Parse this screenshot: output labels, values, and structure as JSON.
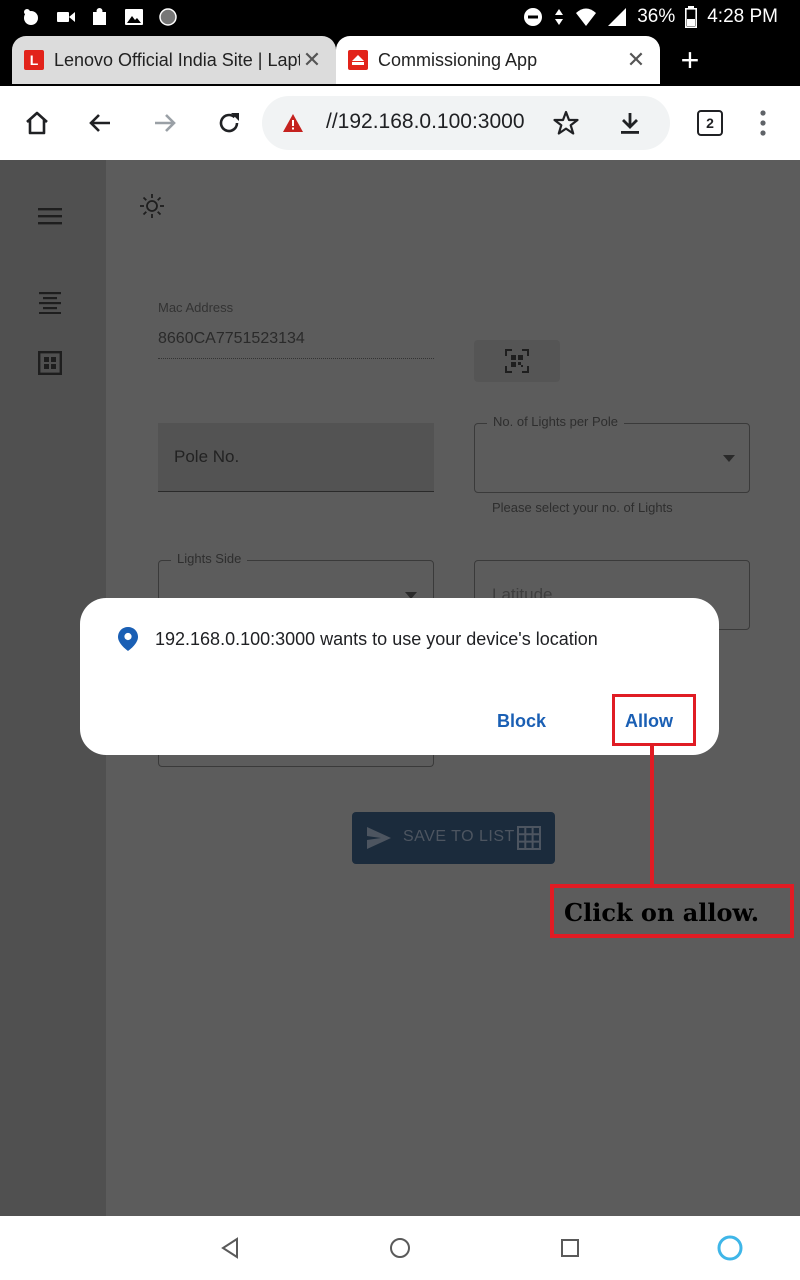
{
  "status_bar": {
    "battery": "36%",
    "time": "4:28 PM"
  },
  "tabs": [
    {
      "title": "Lenovo Official India Site | Laptops",
      "favicon_letter": "L",
      "favicon_color": "#e2231a",
      "active": false
    },
    {
      "title": "Commissioning App",
      "active": true
    }
  ],
  "toolbar": {
    "url": "//192.168.0.100:3000",
    "tab_count": "2"
  },
  "form": {
    "mac_address_label": "Mac Address",
    "mac_address_value": "8660CA7751523134",
    "pole_no_placeholder": "Pole No.",
    "lights_per_pole_label": "No. of Lights per Pole",
    "lights_per_pole_helper": "Please select your no. of Lights",
    "lights_side_label": "Lights Side",
    "latitude_placeholder": "Latitude",
    "save_button_label": "SAVE TO LIST"
  },
  "dialog": {
    "message": "192.168.0.100:3000 wants to use your device's location",
    "block_label": "Block",
    "allow_label": "Allow"
  },
  "annotation": {
    "text": "Click on allow."
  },
  "colors": {
    "accent_blue": "#1a5fb4",
    "annotation_red": "#e01c24",
    "save_button_bg": "#1b2b3c"
  }
}
